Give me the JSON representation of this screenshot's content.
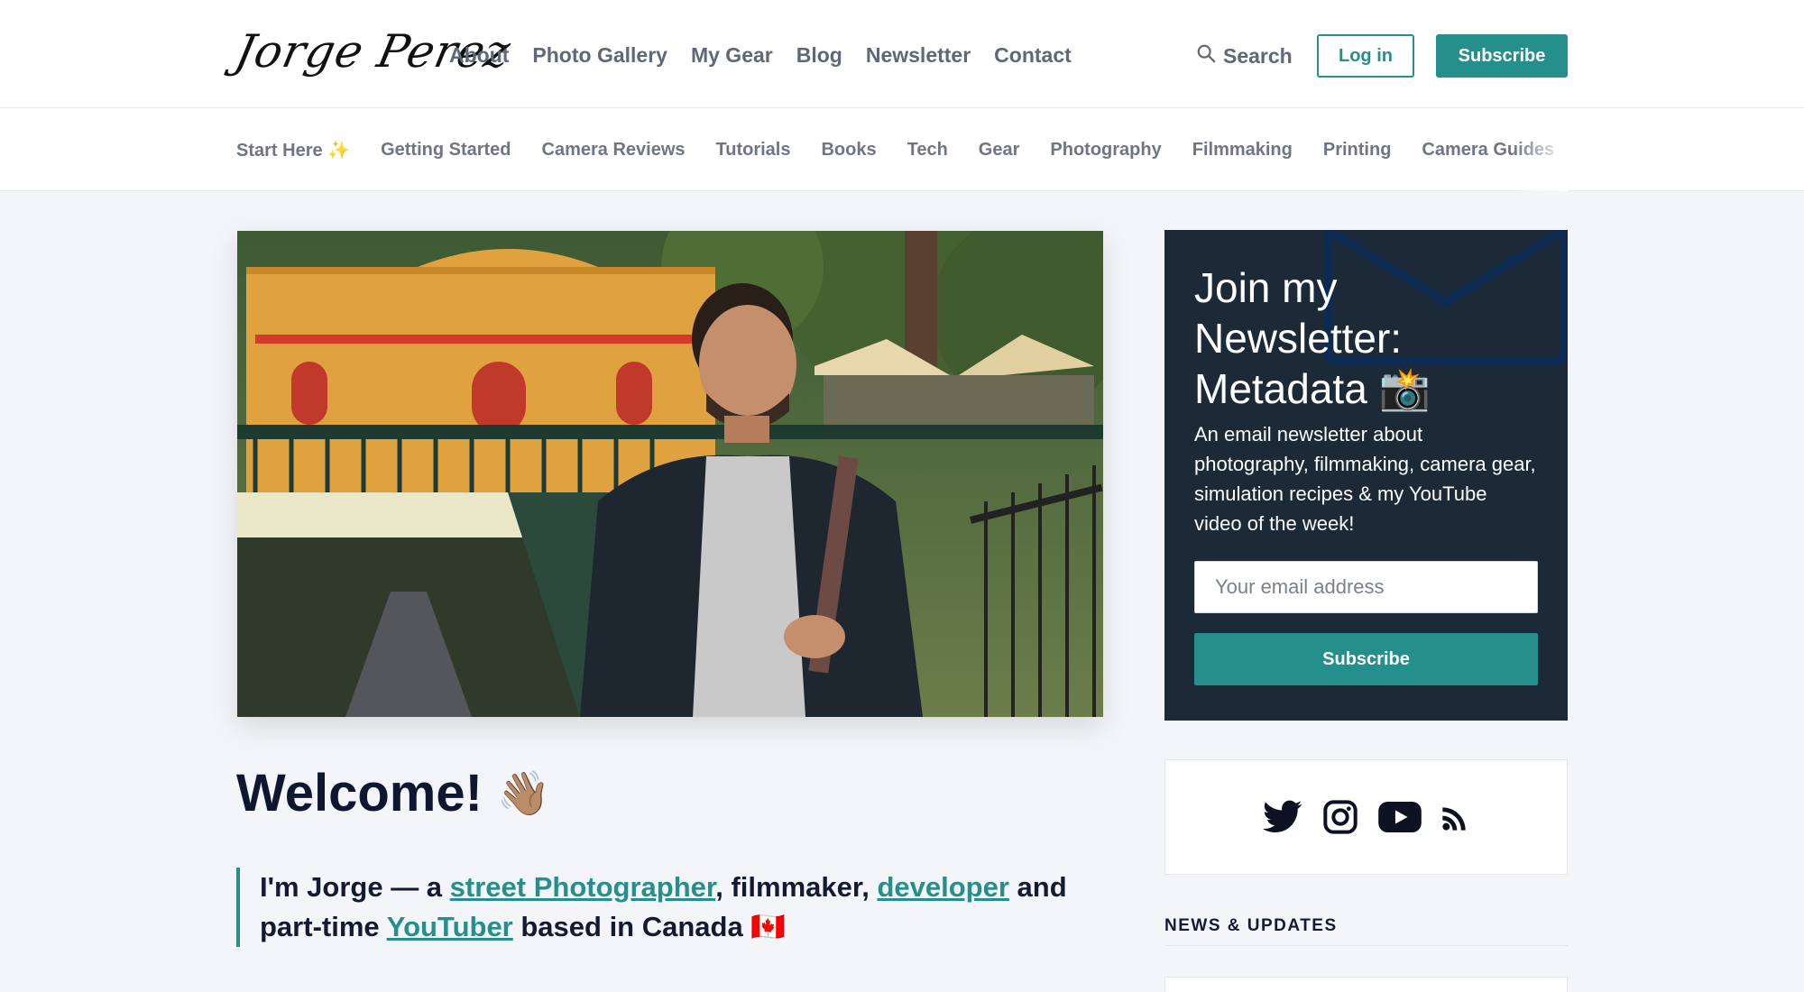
{
  "header": {
    "logo_text": "Jorge Perez",
    "nav": [
      "About",
      "Photo Gallery",
      "My Gear",
      "Blog",
      "Newsletter",
      "Contact"
    ],
    "search_label": "Search",
    "login_label": "Log in",
    "subscribe_label": "Subscribe",
    "accent_color": "#258f8c"
  },
  "categories": [
    "Start Here ✨",
    "Getting Started",
    "Camera Reviews",
    "Tutorials",
    "Books",
    "Tech",
    "Gear",
    "Photography",
    "Filmmaking",
    "Printing",
    "Camera Guides"
  ],
  "main": {
    "welcome_title": "Welcome!",
    "welcome_emoji": "👋🏽",
    "intro": {
      "part1": "I'm Jorge — a ",
      "link1": "street Photographer",
      "part2": ", filmmaker, ",
      "link2": "developer",
      "part3": " and part-time ",
      "link3": "YouTuber",
      "part4": " based in Canada 🇨🇦"
    }
  },
  "sidebar": {
    "newsletter": {
      "title": "Join my Newsletter: Metadata 📸",
      "description": "An email newsletter about photography, filmmaking, camera gear, simulation recipes & my YouTube video of the week!",
      "email_placeholder": "Your email address",
      "button_label": "Subscribe",
      "background": "#1c2a38"
    },
    "social_icons": [
      "twitter-icon",
      "instagram-icon",
      "youtube-icon",
      "rss-icon"
    ],
    "updates_title": "NEWS & UPDATES"
  }
}
